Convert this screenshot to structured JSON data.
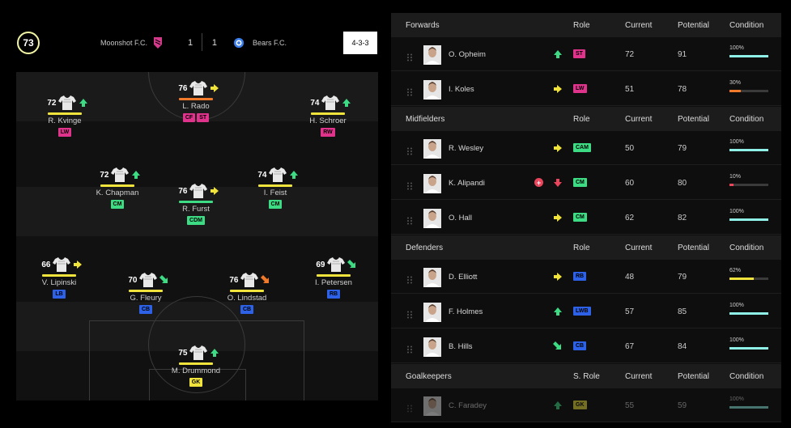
{
  "header": {
    "team_rating": "73",
    "home_team": "Moonshot F.C.",
    "home_score": "1",
    "away_score": "1",
    "away_team": "Bears F.C.",
    "formation": "4-3-3"
  },
  "colors": {
    "yellow": "#f0e33c",
    "green": "#3ddc84",
    "pink": "#e0338c",
    "blue": "#2d62e8",
    "orange": "#f07a2a",
    "cyan_bar": "#8ef0e6",
    "red": "#e9455c"
  },
  "pitch": {
    "players": [
      {
        "rating": "76",
        "name": "L. Rado",
        "trend": "right",
        "trend_color": "yellow",
        "bar_color": "orange",
        "tags": [
          {
            "label": "CF",
            "color": "pink"
          },
          {
            "label": "ST",
            "color": "pink"
          }
        ]
      },
      {
        "rating": "72",
        "name": "R. Kvinge",
        "trend": "up",
        "trend_color": "green",
        "bar_color": "yellow",
        "tags": [
          {
            "label": "LW",
            "color": "pink"
          }
        ]
      },
      {
        "rating": "74",
        "name": "H. Schroer",
        "trend": "up",
        "trend_color": "green",
        "bar_color": "yellow",
        "tags": [
          {
            "label": "RW",
            "color": "pink"
          }
        ]
      },
      {
        "rating": "72",
        "name": "K. Chapman",
        "trend": "up",
        "trend_color": "green",
        "bar_color": "yellow",
        "tags": [
          {
            "label": "CM",
            "color": "green"
          }
        ]
      },
      {
        "rating": "76",
        "name": "R. Furst",
        "trend": "right",
        "trend_color": "yellow",
        "bar_color": "green",
        "tags": [
          {
            "label": "CDM",
            "color": "green"
          }
        ]
      },
      {
        "rating": "74",
        "name": "I. Feist",
        "trend": "up",
        "trend_color": "green",
        "bar_color": "yellow",
        "tags": [
          {
            "label": "CM",
            "color": "green"
          }
        ]
      },
      {
        "rating": "66",
        "name": "V. Lipinski",
        "trend": "right",
        "trend_color": "yellow",
        "bar_color": "yellow",
        "tags": [
          {
            "label": "LB",
            "color": "blue"
          }
        ]
      },
      {
        "rating": "70",
        "name": "G. Fleury",
        "trend": "down-right",
        "trend_color": "green",
        "bar_color": "yellow",
        "tags": [
          {
            "label": "CB",
            "color": "blue"
          }
        ]
      },
      {
        "rating": "76",
        "name": "O. Lindstad",
        "trend": "down-right",
        "trend_color": "orange",
        "bar_color": "yellow",
        "tags": [
          {
            "label": "CB",
            "color": "blue"
          }
        ]
      },
      {
        "rating": "69",
        "name": "I. Petersen",
        "trend": "down-right",
        "trend_color": "green",
        "bar_color": "yellow",
        "tags": [
          {
            "label": "RB",
            "color": "blue"
          }
        ]
      },
      {
        "rating": "75",
        "name": "M. Drummond",
        "trend": "up",
        "trend_color": "green",
        "bar_color": "yellow",
        "tags": [
          {
            "label": "GK",
            "color": "yellow"
          }
        ]
      }
    ]
  },
  "squad": {
    "sections": [
      {
        "title": "Forwards",
        "role_header": "Role",
        "current_header": "Current",
        "potential_header": "Potential",
        "condition_header": "Condition",
        "rows": [
          {
            "name": "O. Opheim",
            "trend": "up",
            "trend_color": "green",
            "role": "ST",
            "role_color": "pink",
            "current": "72",
            "potential": "91",
            "condition": "100%",
            "condition_level": 1.0,
            "condition_color": "cyan_bar",
            "injured": false,
            "dimmed": false
          },
          {
            "name": "I. Koles",
            "trend": "right",
            "trend_color": "yellow",
            "role": "LW",
            "role_color": "pink",
            "current": "51",
            "potential": "78",
            "condition": "30%",
            "condition_level": 0.3,
            "condition_color": "orange",
            "injured": false,
            "dimmed": false
          }
        ]
      },
      {
        "title": "Midfielders",
        "role_header": "Role",
        "current_header": "Current",
        "potential_header": "Potential",
        "condition_header": "Condition",
        "rows": [
          {
            "name": "R. Wesley",
            "trend": "right",
            "trend_color": "yellow",
            "role": "CAM",
            "role_color": "green",
            "current": "50",
            "potential": "79",
            "condition": "100%",
            "condition_level": 1.0,
            "condition_color": "cyan_bar",
            "injured": false,
            "dimmed": false
          },
          {
            "name": "K. Alipandi",
            "trend": "down",
            "trend_color": "red",
            "role": "CM",
            "role_color": "green",
            "current": "60",
            "potential": "80",
            "condition": "10%",
            "condition_level": 0.1,
            "condition_color": "red",
            "injured": true,
            "dimmed": false
          },
          {
            "name": "O. Hall",
            "trend": "right",
            "trend_color": "yellow",
            "role": "CM",
            "role_color": "green",
            "current": "62",
            "potential": "82",
            "condition": "100%",
            "condition_level": 1.0,
            "condition_color": "cyan_bar",
            "injured": false,
            "dimmed": false
          }
        ]
      },
      {
        "title": "Defenders",
        "role_header": "Role",
        "current_header": "Current",
        "potential_header": "Potential",
        "condition_header": "Condition",
        "rows": [
          {
            "name": "D. Elliott",
            "trend": "right",
            "trend_color": "yellow",
            "role": "RB",
            "role_color": "blue",
            "current": "48",
            "potential": "79",
            "condition": "62%",
            "condition_level": 0.62,
            "condition_color": "yellow",
            "injured": false,
            "dimmed": false
          },
          {
            "name": "F. Holmes",
            "trend": "up",
            "trend_color": "green",
            "role": "LWB",
            "role_color": "blue",
            "current": "57",
            "potential": "85",
            "condition": "100%",
            "condition_level": 1.0,
            "condition_color": "cyan_bar",
            "injured": false,
            "dimmed": false
          },
          {
            "name": "B. Hills",
            "trend": "down-right",
            "trend_color": "green",
            "role": "CB",
            "role_color": "blue",
            "current": "67",
            "potential": "84",
            "condition": "100%",
            "condition_level": 1.0,
            "condition_color": "cyan_bar",
            "injured": false,
            "dimmed": false
          }
        ]
      },
      {
        "title": "Goalkeepers",
        "role_header": "S. Role",
        "current_header": "Current",
        "potential_header": "Potential",
        "condition_header": "Condition",
        "rows": [
          {
            "name": "C. Faradey",
            "trend": "up",
            "trend_color": "green",
            "role": "GK",
            "role_color": "yellow",
            "current": "55",
            "potential": "59",
            "condition": "100%",
            "condition_level": 1.0,
            "condition_color": "cyan_bar",
            "injured": false,
            "dimmed": true
          }
        ]
      }
    ]
  }
}
